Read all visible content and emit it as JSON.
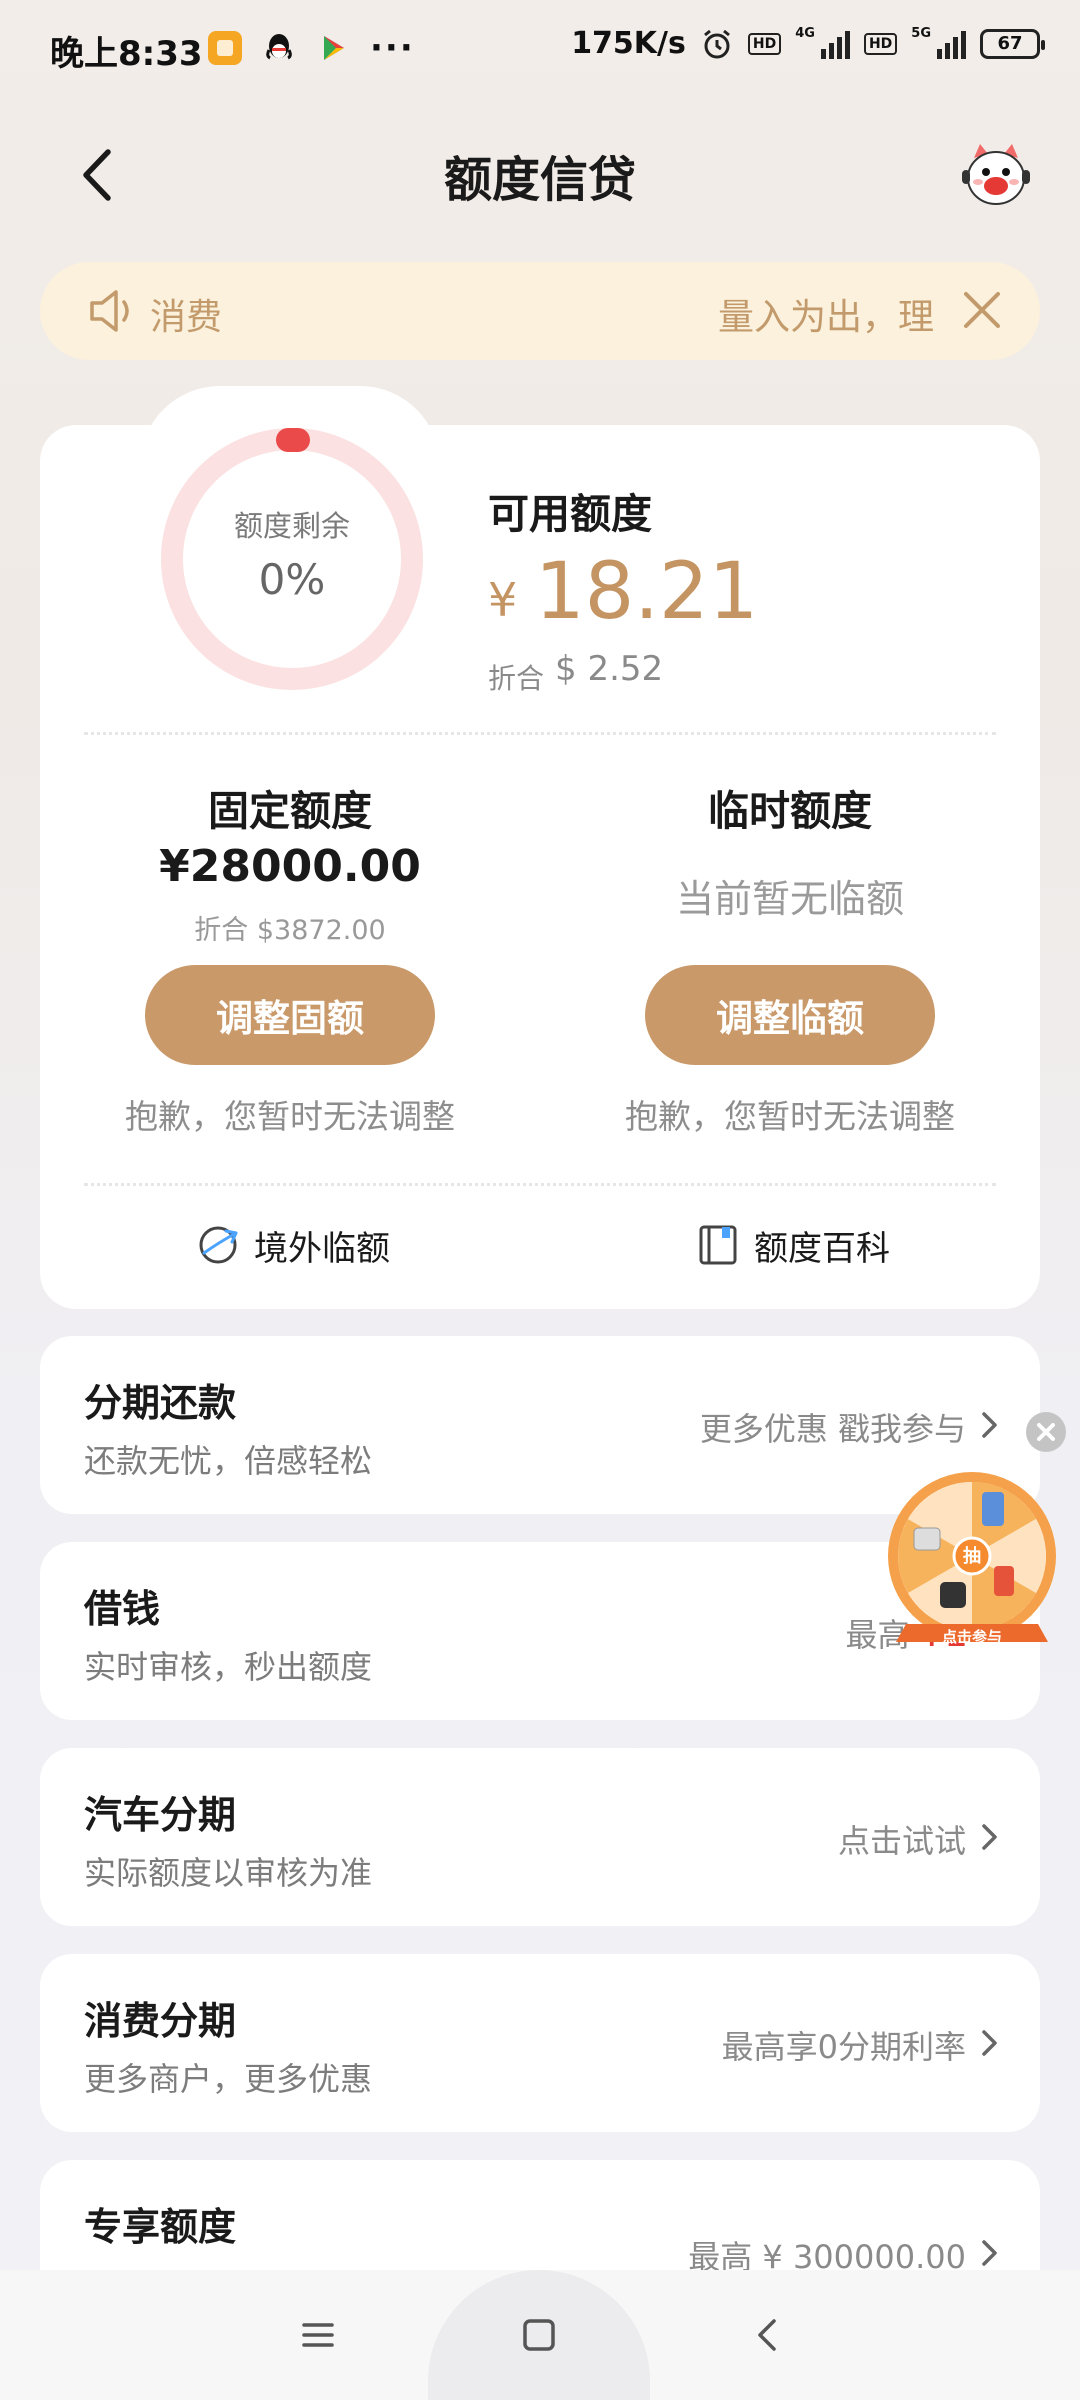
{
  "status_bar": {
    "time": "晚上8:33",
    "dots": "···",
    "net_speed": "175K/s",
    "hd_1": "HD",
    "net_1": "4G",
    "hd_2": "HD",
    "net_2": "5G",
    "battery": "67",
    "app_icons": [
      "note-app-icon",
      "qq-icon",
      "play-store-icon"
    ]
  },
  "header": {
    "title": "额度信贷",
    "back_icon": "chevron-left-icon",
    "mascot_icon": "mascot-icon"
  },
  "notice": {
    "label": "消费",
    "scroll_text": "量入为出，理",
    "icon": "speaker-icon",
    "close_icon": "close-icon"
  },
  "credit": {
    "ring_label": "额度剩余",
    "ring_value": "0%",
    "ring_remaining_fraction": 0,
    "available_label": "可用额度",
    "currency_symbol": "¥",
    "available_value": "18.21",
    "converted_label": "折合",
    "converted_value": "$ 2.52"
  },
  "fixed_quota": {
    "title": "固定额度",
    "amount": "¥28000.00",
    "converted": "折合 $3872.00",
    "button": "调整固额",
    "note": "抱歉，您暂时无法调整"
  },
  "temp_quota": {
    "title": "临时额度",
    "none_text": "当前暂无临额",
    "button": "调整临额",
    "note": "抱歉，您暂时无法调整"
  },
  "links": {
    "overseas": "境外临额",
    "wiki": "额度百科"
  },
  "list_items": [
    {
      "title": "分期还款",
      "sub": "还款无忧，倍感轻松",
      "right": "更多优惠 戳我参与"
    },
    {
      "title": "借钱",
      "sub": "实时审核，秒出额度",
      "right_prefix": "最高",
      "right_highlight": "¥1"
    },
    {
      "title": "汽车分期",
      "sub": "实际额度以审核为准",
      "right": "点击试试"
    },
    {
      "title": "消费分期",
      "sub": "更多商户，更多优惠",
      "right": "最高享0分期利率"
    },
    {
      "title": "专享额度",
      "sub": "",
      "right": "最高 ¥ 300000.00"
    }
  ],
  "wheel": {
    "center": "抽",
    "banner": "点击参与"
  },
  "colors": {
    "gold": "#c9996a",
    "amount_gold": "#c49462",
    "notice_bg": "#fbf1dc",
    "red": "#e53935"
  }
}
